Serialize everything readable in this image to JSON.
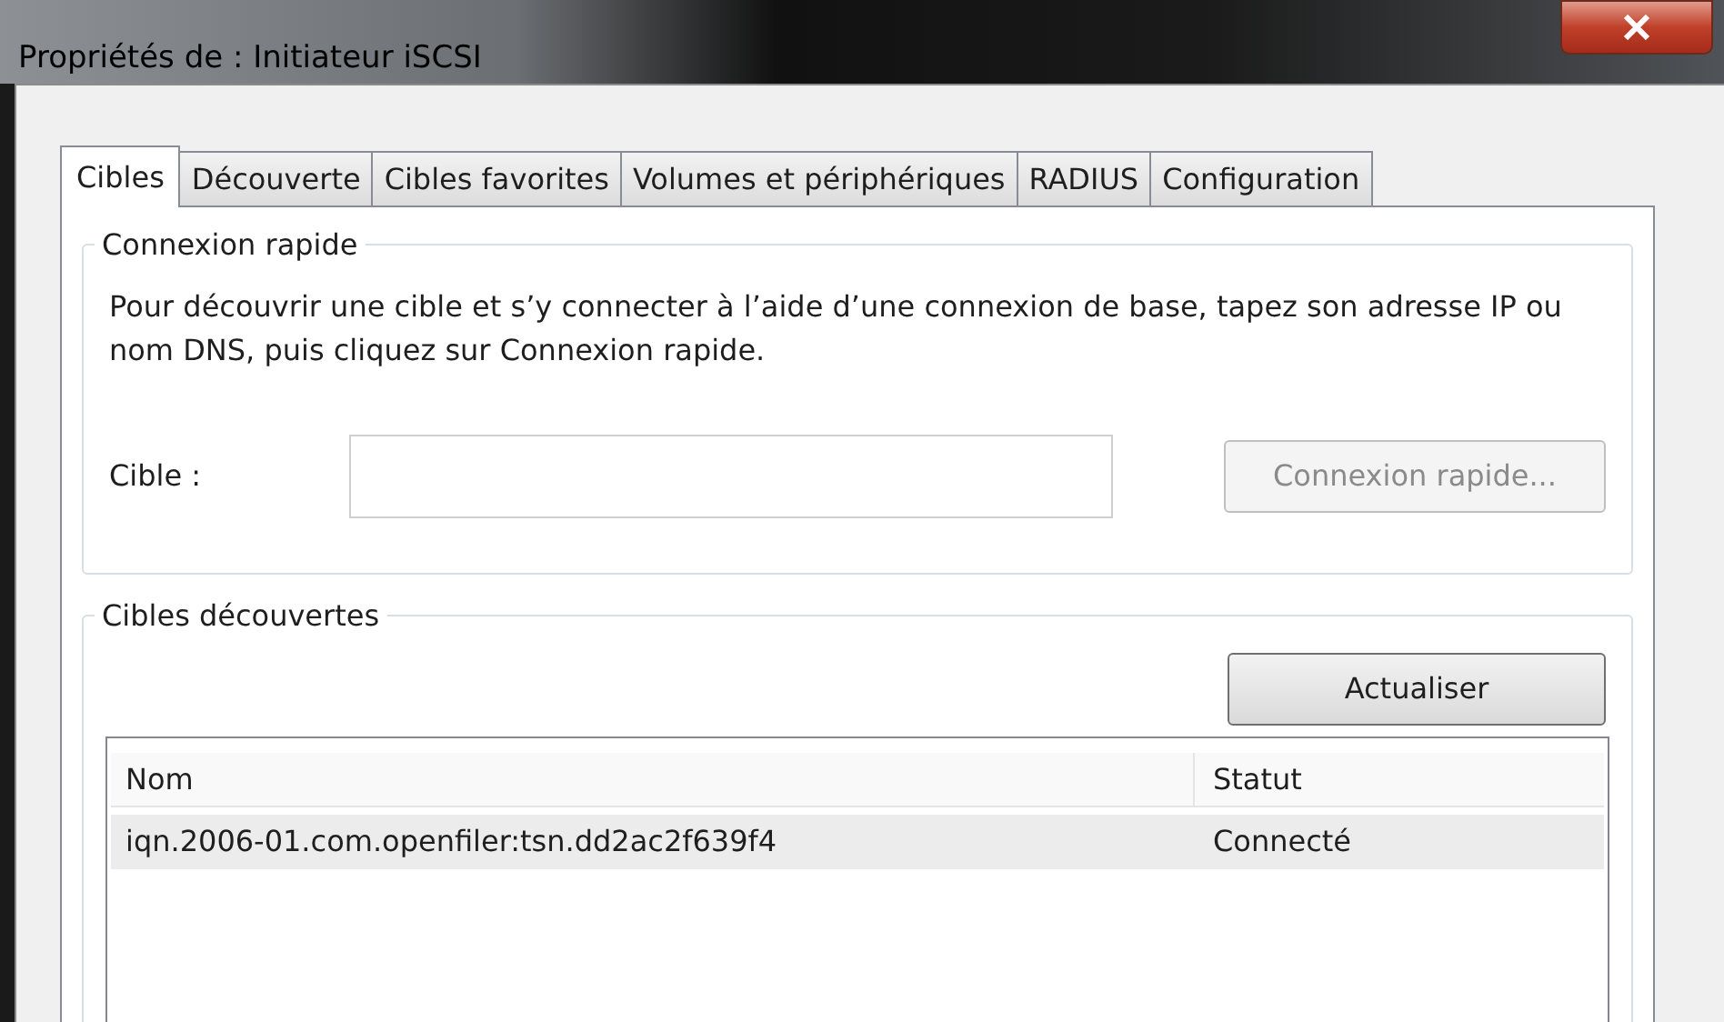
{
  "window": {
    "title": "Propriétés de : Initiateur iSCSI"
  },
  "tabs": [
    {
      "label": "Cibles",
      "selected": true
    },
    {
      "label": "Découverte",
      "selected": false
    },
    {
      "label": "Cibles favorites",
      "selected": false
    },
    {
      "label": "Volumes et périphériques",
      "selected": false
    },
    {
      "label": "RADIUS",
      "selected": false
    },
    {
      "label": "Configuration",
      "selected": false
    }
  ],
  "quick_connect": {
    "legend": "Connexion rapide",
    "description": "Pour découvrir une cible et s’y connecter à l’aide d’une connexion de base, tapez son adresse IP ou nom DNS, puis cliquez sur Connexion rapide.",
    "target_label": "Cible :",
    "button": {
      "label": "Connexion rapide...",
      "disabled": true
    }
  },
  "discovered": {
    "legend": "Cibles découvertes",
    "refresh_button": "Actualiser",
    "columns": [
      "Nom",
      "Statut"
    ],
    "rows": [
      {
        "name": "iqn.2006-01.com.openfiler:tsn.dd2ac2f639f4",
        "status": "Connecté",
        "selected": true
      }
    ]
  }
}
